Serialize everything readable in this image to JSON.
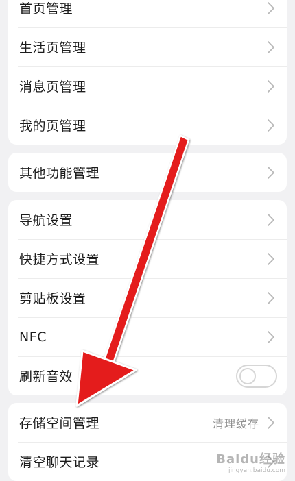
{
  "groups": [
    {
      "items": [
        {
          "label": "首页管理"
        },
        {
          "label": "生活页管理"
        },
        {
          "label": "消息页管理"
        },
        {
          "label": "我的页管理"
        }
      ]
    },
    {
      "items": [
        {
          "label": "其他功能管理"
        }
      ]
    },
    {
      "items": [
        {
          "label": "导航设置"
        },
        {
          "label": "快捷方式设置"
        },
        {
          "label": "剪贴板设置"
        },
        {
          "label": "NFC"
        },
        {
          "label": "刷新音效",
          "toggle": false
        }
      ]
    },
    {
      "items": [
        {
          "label": "存储空间管理",
          "value": "清理缓存"
        },
        {
          "label": "清空聊天记录"
        }
      ]
    }
  ],
  "watermark": {
    "text": "Baidu经验",
    "sub": "jingyan.baidu.com"
  },
  "colors": {
    "annotation_arrow": "#e41a1a",
    "background": "#f1f1f3"
  },
  "icons": {
    "row_chevron": "chevron-right-icon"
  }
}
